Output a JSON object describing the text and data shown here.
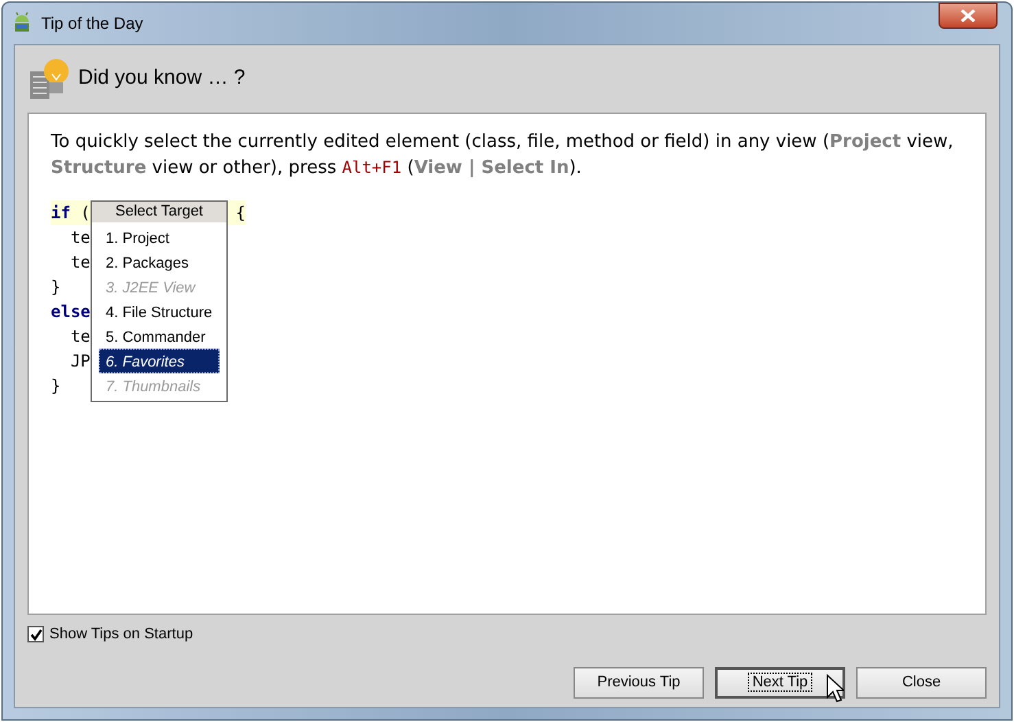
{
  "window": {
    "title": "Tip of the Day"
  },
  "heading": "Did you know … ?",
  "tip": [
    {
      "kind": "plain",
      "text": "To quickly select the currently edited element (class, file, method or field) in any view ("
    },
    {
      "kind": "ui",
      "text": "Project"
    },
    {
      "kind": "plain",
      "text": " view, "
    },
    {
      "kind": "ui",
      "text": "Structure"
    },
    {
      "kind": "plain",
      "text": " view or other), press "
    },
    {
      "kind": "key",
      "text": "Alt+F1"
    },
    {
      "kind": "plain",
      "text": " ("
    },
    {
      "kind": "ui",
      "text": "View | Select In"
    },
    {
      "kind": "plain",
      "text": ")."
    }
  ],
  "code": [
    {
      "keyword": "if",
      "text": " (",
      "tail": "{",
      "current": true
    },
    {
      "text": "  te",
      "current": false
    },
    {
      "text": "  te",
      "current": false
    },
    {
      "text": "}",
      "current": false
    },
    {
      "keyword": "else",
      "current": false
    },
    {
      "text": "  te",
      "current": false
    },
    {
      "text": "  JP",
      "current": false
    },
    {
      "text": "}",
      "current": false
    }
  ],
  "popup": {
    "title": "Select Target",
    "items": [
      {
        "label": "1. Project",
        "selected": false,
        "disabled": false
      },
      {
        "label": "2. Packages",
        "selected": false,
        "disabled": false
      },
      {
        "label": "3. J2EE View",
        "selected": false,
        "disabled": true
      },
      {
        "label": "4. File Structure",
        "selected": false,
        "disabled": false
      },
      {
        "label": "5. Commander",
        "selected": false,
        "disabled": false
      },
      {
        "label": "6. Favorites",
        "selected": true,
        "disabled": false
      },
      {
        "label": "7. Thumbnails",
        "selected": false,
        "disabled": true
      }
    ]
  },
  "show_tips": {
    "label": "Show Tips on Startup",
    "checked": true
  },
  "buttons": [
    {
      "label": "Previous Tip",
      "focused": false
    },
    {
      "label": "Next Tip",
      "focused": true
    },
    {
      "label": "Close",
      "focused": false
    }
  ]
}
